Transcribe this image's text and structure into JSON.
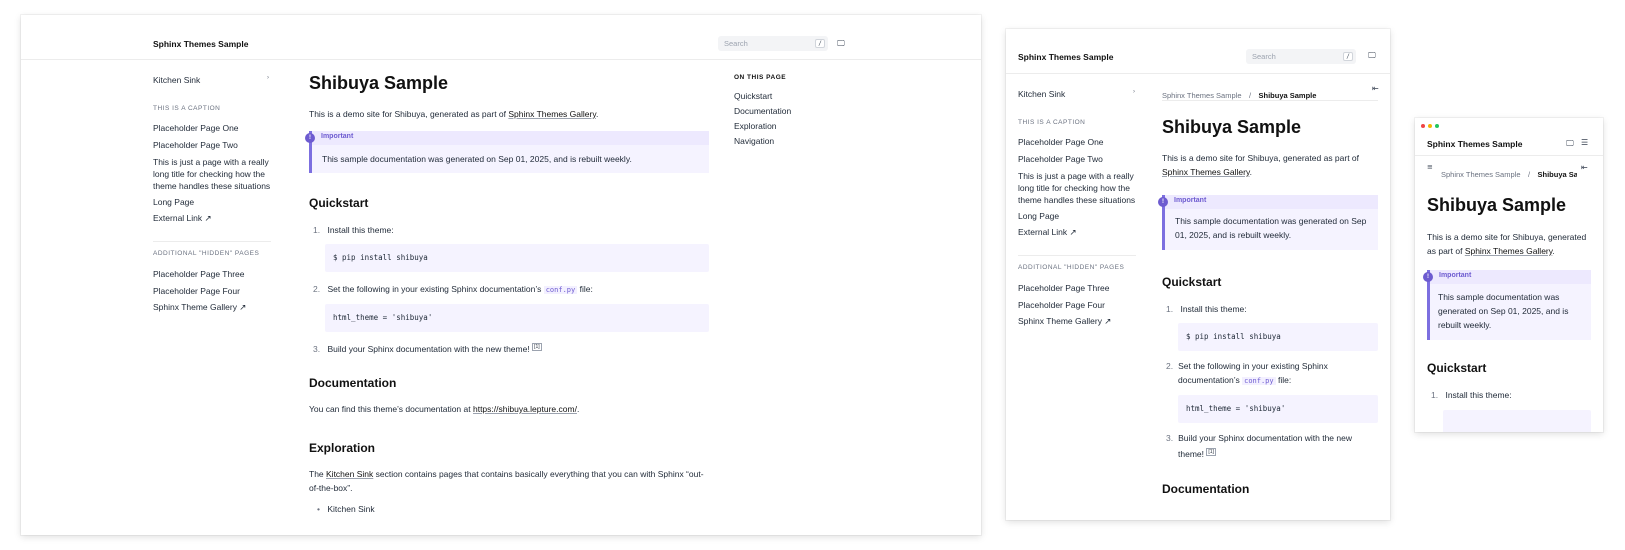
{
  "site_title": "Sphinx Themes Sample",
  "search": {
    "placeholder": "Search",
    "shortcut": "/"
  },
  "icons": {
    "monitor": "monitor-icon",
    "chevron": "chevron-right-icon",
    "external": "external-link-icon",
    "toc": "toc-icon",
    "menu": "menu-icon",
    "hamburger": "hamburger-icon"
  },
  "sidebar": {
    "kitchen_sink": "Kitchen Sink",
    "caption1": "THIS IS A CAPTION",
    "items": [
      "Placeholder Page One",
      "Placeholder Page Two",
      "This is just a page with a really long title for checking how the theme handles these situations",
      "Long Page",
      "External Link ↗"
    ],
    "long_title_lines": [
      "This is just a page with a really",
      "long title for checking how the",
      "theme handles these situations"
    ],
    "caption2": "ADDITIONAL \"HIDDEN\" PAGES",
    "items2": [
      "Placeholder Page Three",
      "Placeholder Page Four",
      "Sphinx Theme Gallery ↗"
    ]
  },
  "breadcrumb": {
    "parent": "Sphinx Themes Sample",
    "sep": "/",
    "current": "Shibuya Sample",
    "current_cut": "Shibuya San"
  },
  "content": {
    "title": "Shibuya Sample",
    "intro_prefix": "This is a demo site for Shibuya, generated as part of ",
    "intro_link": "Sphinx Themes Gallery",
    "intro_suffix": ".",
    "admonition_title": "Important",
    "admonition_icon": "!",
    "admonition_text": "This sample documentation was generated on Sep 01, 2025, and is rebuilt weekly.",
    "quickstart_h": "Quickstart",
    "step1_num": "1.",
    "step1": "Install this theme:",
    "code1": "$ pip install shibuya",
    "step2_num": "2.",
    "step2_prefix": "Set the following in your existing Sphinx documentation’s ",
    "step2_code": "conf.py",
    "step2_suffix": " file:",
    "code2": "html_theme = 'shibuya'",
    "step3_num": "3.",
    "step3": "Build your Sphinx documentation with the new theme! ",
    "footnote": "[1]",
    "documentation_h": "Documentation",
    "doc_prefix": "You can find this theme’s documentation at ",
    "doc_link": "https://shibuya.lepture.com/",
    "exploration_h": "Exploration",
    "exp_prefix": "The ",
    "exp_link": "Kitchen Sink",
    "exp_suffix": " section contains pages that contains basically everything that you can with Sphinx “out-of-the-box”.",
    "bullet1": "Kitchen Sink"
  },
  "toc": {
    "heading": "ON THIS PAGE",
    "items": [
      "Quickstart",
      "Documentation",
      "Exploration",
      "Navigation"
    ]
  },
  "mid": {
    "intro_l1": "This is a demo site for Shibuya, generated as part of",
    "adm_l1": "This sample documentation was generated on Sep",
    "adm_l2": "01, 2025, and is rebuilt weekly.",
    "step2_l1": "Set the following in your existing Sphinx",
    "step2_l2_prefix": "documentation’s ",
    "step3_l1": "Build your Sphinx documentation with the new",
    "step3_l2": "theme! "
  },
  "small": {
    "intro_l1": "This is a demo site for Shibuya, generated",
    "intro_l2_prefix": "as part of ",
    "adm_l1": "This sample documentation was",
    "adm_l2": "generated on Sep 01, 2025, and is",
    "adm_l3": "rebuilt weekly."
  },
  "colors": {
    "accent": "#6d5bd0",
    "admonition_bg": "#f5f3ff"
  }
}
